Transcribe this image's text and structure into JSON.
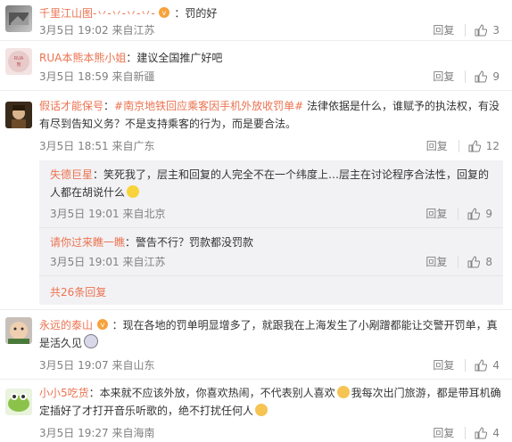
{
  "comments": [
    {
      "name": "千里江山图-丷-丷-丷-丷-",
      "badge": "vip-badge-icon",
      "text": "：罚的好",
      "time": "3月5日 19:02",
      "source": "来自江苏",
      "reply_label": "回复",
      "likes": "3"
    },
    {
      "name": "RUA本熊本熊小姐",
      "text": "：建议全国推广好吧",
      "time": "3月5日 18:59",
      "source": "来自新疆",
      "reply_label": "回复",
      "likes": "9"
    },
    {
      "name": "假话才能保号",
      "text_prefix": "：",
      "topic": "#南京地铁回应乘客因手机外放收罚单#",
      "text": " 法律依据是什么，谁赋予的执法权，有没有尽到告知义务？不是支持乘客的行为，而是要合法。",
      "time": "3月5日 18:51",
      "source": "来自广东",
      "reply_label": "回复",
      "likes": "12",
      "replies": [
        {
          "name": "失德巨星",
          "text": "：笑死我了，层主和回复的人完全不在一个纬度上…层主在讨论程序合法性，回复的人都在胡说什么",
          "time": "3月5日 19:01",
          "source": "来自北京",
          "reply_label": "回复",
          "likes": "9"
        },
        {
          "name": "请你过来瞧一瞧",
          "text": "：警告不行？罚款都没罚款",
          "time": "3月5日 19:01",
          "source": "来自江苏",
          "reply_label": "回复",
          "likes": "8"
        }
      ],
      "more_label": "共26条回复"
    },
    {
      "name": "永远的泰山",
      "text": "：现在各地的罚单明显增多了，就跟我在上海发生了小剐蹭都能让交警开罚单，真是活久见",
      "time": "3月5日 19:07",
      "source": "来自山东",
      "reply_label": "回复",
      "likes": "4"
    },
    {
      "name": "小小5吃货",
      "text_a": "：本来就不应该外放，你喜欢热闹，不代表别人喜欢",
      "text_b": "我每次出门旅游，都是带耳机确定插好了才打开音乐听歌的，绝不打扰任何人",
      "time": "3月5日 19:27",
      "source": "来自海南",
      "reply_label": "回复",
      "likes": "4"
    }
  ]
}
